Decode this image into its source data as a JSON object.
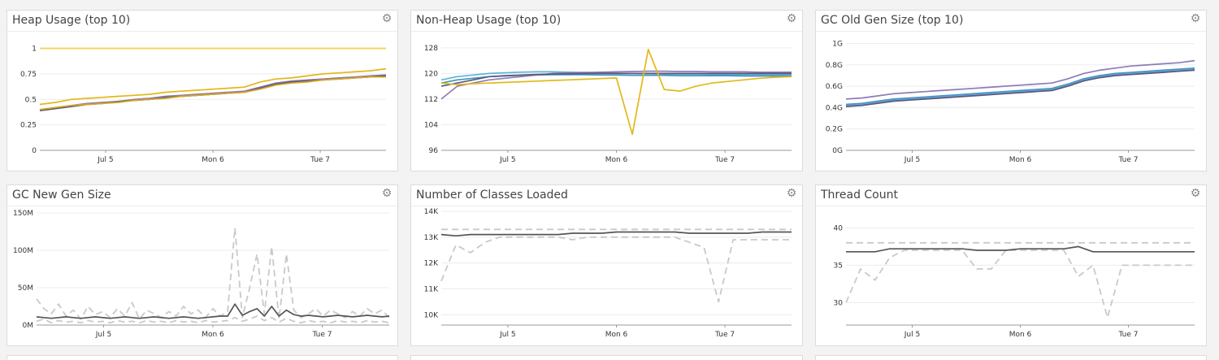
{
  "panels": [
    {
      "title": "Heap Usage (top 10)",
      "chart_data": {
        "type": "line",
        "x_ticks": [
          "Jul 5",
          "Mon 6",
          "Tue 7"
        ],
        "y_ticks": [
          "0",
          "0.25",
          "0.5",
          "0.75",
          "1"
        ],
        "ylim": [
          0,
          1.1
        ],
        "series": [
          {
            "color": "#f2d24b",
            "values": [
              1,
              1,
              1,
              1,
              1,
              1,
              1,
              1,
              1,
              1,
              1,
              1,
              1,
              1,
              1,
              1,
              1,
              1,
              1,
              1,
              1,
              1,
              1
            ]
          },
          {
            "color": "#e3b818",
            "values": [
              0.45,
              0.47,
              0.5,
              0.51,
              0.52,
              0.53,
              0.54,
              0.55,
              0.57,
              0.58,
              0.59,
              0.6,
              0.61,
              0.62,
              0.67,
              0.7,
              0.71,
              0.73,
              0.75,
              0.76,
              0.77,
              0.78,
              0.8
            ]
          },
          {
            "color": "#8f7bb5",
            "values": [
              0.4,
              0.42,
              0.44,
              0.46,
              0.47,
              0.48,
              0.5,
              0.51,
              0.53,
              0.54,
              0.55,
              0.56,
              0.57,
              0.58,
              0.62,
              0.66,
              0.68,
              0.69,
              0.7,
              0.71,
              0.72,
              0.73,
              0.74
            ]
          },
          {
            "color": "#5a5a78",
            "values": [
              0.39,
              0.41,
              0.43,
              0.45,
              0.46,
              0.48,
              0.49,
              0.5,
              0.52,
              0.53,
              0.54,
              0.55,
              0.56,
              0.57,
              0.61,
              0.65,
              0.67,
              0.68,
              0.69,
              0.7,
              0.71,
              0.72,
              0.73
            ]
          },
          {
            "color": "#d9a81a",
            "values": [
              0.4,
              0.42,
              0.44,
              0.45,
              0.46,
              0.47,
              0.49,
              0.5,
              0.51,
              0.53,
              0.54,
              0.55,
              0.56,
              0.57,
              0.6,
              0.64,
              0.66,
              0.67,
              0.69,
              0.7,
              0.71,
              0.72,
              0.72
            ]
          }
        ]
      }
    },
    {
      "title": "Non-Heap Usage (top 10)",
      "chart_data": {
        "type": "line",
        "x_ticks": [
          "Jul 5",
          "Mon 6",
          "Tue 7"
        ],
        "y_ticks": [
          "96",
          "104",
          "112",
          "120",
          "128"
        ],
        "ylim": [
          96,
          131
        ],
        "series": [
          {
            "color": "#5fb3d9",
            "values": [
              118,
              119,
              119.5,
              120,
              120.2,
              120.4,
              120.5,
              120.5,
              120.4,
              120.3,
              120.2,
              120.1,
              120,
              119.9,
              119.8,
              119.8,
              119.8,
              119.7,
              119.7,
              119.6,
              119.6,
              119.6,
              119.6
            ]
          },
          {
            "color": "#3f93c4",
            "values": [
              117,
              118,
              118.5,
              119,
              119.2,
              119.4,
              119.5,
              119.6,
              119.6,
              119.6,
              119.5,
              119.5,
              119.4,
              119.4,
              119.4,
              119.3,
              119.3,
              119.3,
              119.3,
              119.2,
              119.2,
              119.2,
              119.2
            ]
          },
          {
            "color": "#8f7bb5",
            "values": [
              112,
              116,
              117,
              118,
              118.5,
              119,
              119.5,
              120,
              120.2,
              120.3,
              120.4,
              120.5,
              120.6,
              120.7,
              120.7,
              120.6,
              120.6,
              120.5,
              120.5,
              120.5,
              120.4,
              120.4,
              120.4
            ]
          },
          {
            "color": "#5a5a78",
            "values": [
              116,
              117,
              118,
              119,
              119.3,
              119.5,
              119.7,
              119.8,
              119.9,
              120,
              120,
              120,
              120,
              120,
              120,
              120,
              120,
              120,
              120,
              120,
              120,
              120,
              120
            ]
          },
          {
            "color": "#e3b818",
            "values": [
              117,
              116.5,
              116.8,
              117,
              117.2,
              117.4,
              117.6,
              117.8,
              118,
              118.2,
              118.4,
              118.6,
              101,
              127.5,
              115,
              114.5,
              116,
              117,
              117.5,
              118,
              118.5,
              118.8,
              119
            ]
          }
        ]
      }
    },
    {
      "title": "GC Old Gen Size (top 10)",
      "chart_data": {
        "type": "line",
        "x_ticks": [
          "Jul 5",
          "Mon 6",
          "Tue 7"
        ],
        "y_ticks": [
          "0G",
          "0.2G",
          "0.4G",
          "0.6G",
          "0.8G",
          "1G"
        ],
        "ylim": [
          0,
          1.05
        ],
        "series": [
          {
            "color": "#8f7bb5",
            "values": [
              0.48,
              0.49,
              0.51,
              0.53,
              0.54,
              0.55,
              0.56,
              0.57,
              0.58,
              0.59,
              0.6,
              0.61,
              0.62,
              0.63,
              0.67,
              0.72,
              0.75,
              0.77,
              0.79,
              0.8,
              0.81,
              0.82,
              0.84
            ]
          },
          {
            "color": "#3f93c4",
            "values": [
              0.43,
              0.44,
              0.46,
              0.48,
              0.49,
              0.5,
              0.51,
              0.52,
              0.53,
              0.54,
              0.55,
              0.56,
              0.57,
              0.58,
              0.62,
              0.67,
              0.7,
              0.72,
              0.73,
              0.74,
              0.75,
              0.76,
              0.77
            ]
          },
          {
            "color": "#6a9fd4",
            "values": [
              0.42,
              0.43,
              0.45,
              0.47,
              0.48,
              0.49,
              0.5,
              0.51,
              0.52,
              0.53,
              0.54,
              0.55,
              0.56,
              0.57,
              0.61,
              0.66,
              0.69,
              0.71,
              0.72,
              0.73,
              0.74,
              0.75,
              0.76
            ]
          },
          {
            "color": "#5a5a78",
            "values": [
              0.41,
              0.42,
              0.44,
              0.46,
              0.47,
              0.48,
              0.49,
              0.5,
              0.51,
              0.52,
              0.53,
              0.54,
              0.55,
              0.56,
              0.6,
              0.65,
              0.68,
              0.7,
              0.71,
              0.72,
              0.73,
              0.74,
              0.75
            ]
          }
        ]
      }
    },
    {
      "title": "GC New Gen Size",
      "chart_data": {
        "type": "line",
        "x_ticks": [
          "Jul 5",
          "Mon 6",
          "Tue 7"
        ],
        "y_ticks": [
          "0M",
          "50M",
          "100M",
          "150M"
        ],
        "ylim": [
          0,
          150
        ],
        "series": [
          {
            "color": "#c9c9c9",
            "dashed": true,
            "values": [
              35,
              22,
              15,
              28,
              12,
              20,
              8,
              25,
              14,
              18,
              10,
              22,
              12,
              30,
              8,
              20,
              15,
              10,
              18,
              12,
              25,
              15,
              20,
              10,
              22,
              12,
              18,
              130,
              10,
              50,
              95,
              15,
              105,
              8,
              95,
              20,
              10,
              15,
              22,
              12,
              20,
              15,
              10,
              18,
              12,
              22,
              15,
              20,
              10
            ]
          },
          {
            "color": "#c9c9c9",
            "dashed": true,
            "values": [
              5,
              8,
              3,
              6,
              4,
              5,
              3,
              6,
              4,
              5,
              3,
              6,
              4,
              5,
              3,
              6,
              4,
              5,
              3,
              6,
              4,
              5,
              3,
              6,
              4,
              5,
              6,
              10,
              5,
              8,
              12,
              6,
              10,
              4,
              9,
              5,
              3,
              6,
              4,
              5,
              3,
              6,
              4,
              5,
              3,
              6,
              4,
              5,
              3
            ]
          },
          {
            "color": "#555555",
            "values": [
              11,
              10,
              9,
              10,
              11,
              10,
              9,
              10,
              11,
              10,
              9,
              10,
              11,
              10,
              9,
              10,
              11,
              10,
              9,
              10,
              11,
              10,
              9,
              10,
              11,
              12,
              12,
              28,
              13,
              18,
              22,
              12,
              25,
              12,
              20,
              14,
              12,
              13,
              12,
              11,
              12,
              13,
              12,
              11,
              12,
              13,
              12,
              11,
              12
            ]
          }
        ]
      }
    },
    {
      "title": "Number of Classes Loaded",
      "chart_data": {
        "type": "line",
        "x_ticks": [
          "Jul 5",
          "Mon 6",
          "Tue 7"
        ],
        "y_ticks": [
          "10K",
          "11K",
          "12K",
          "13K",
          "14K"
        ],
        "ylim": [
          9600,
          14000
        ],
        "series": [
          {
            "color": "#c9c9c9",
            "dashed": true,
            "values": [
              13300,
              13300,
              13300,
              13300,
              13300,
              13300,
              13300,
              13300,
              13300,
              13300,
              13300,
              13300,
              13300,
              13300,
              13300,
              13300,
              13300,
              13300,
              13300,
              13300,
              13300,
              13300,
              13300,
              13300,
              13300
            ]
          },
          {
            "color": "#c9c9c9",
            "dashed": true,
            "values": [
              11300,
              12700,
              12400,
              12800,
              13000,
              13000,
              13000,
              13000,
              13000,
              12900,
              13000,
              13000,
              13000,
              13000,
              13000,
              13000,
              13000,
              12800,
              12600,
              10500,
              12900,
              12900,
              12900,
              12900,
              12900
            ]
          },
          {
            "color": "#555555",
            "values": [
              13100,
              13050,
              13100,
              13100,
              13100,
              13100,
              13100,
              13100,
              13100,
              13150,
              13150,
              13150,
              13200,
              13200,
              13200,
              13200,
              13200,
              13150,
              13150,
              13150,
              13150,
              13150,
              13200,
              13200,
              13200
            ]
          }
        ]
      }
    },
    {
      "title": "Thread Count",
      "chart_data": {
        "type": "line",
        "x_ticks": [
          "Jul 5",
          "Mon 6",
          "Tue 7"
        ],
        "y_ticks": [
          "30",
          "35",
          "40"
        ],
        "ylim": [
          27,
          42
        ],
        "series": [
          {
            "color": "#c9c9c9",
            "dashed": true,
            "values": [
              38,
              38,
              38,
              38,
              38,
              38,
              38,
              38,
              38,
              38,
              38,
              38,
              38,
              38,
              38,
              38,
              38,
              38,
              38,
              38,
              38,
              38,
              38,
              38,
              38
            ]
          },
          {
            "color": "#c9c9c9",
            "dashed": true,
            "values": [
              30,
              34.5,
              33,
              36,
              37,
              37,
              37,
              37,
              37,
              34.5,
              34.5,
              37,
              37,
              37,
              37,
              37,
              33.5,
              35,
              28,
              35,
              35,
              35,
              35,
              35,
              35
            ]
          },
          {
            "color": "#555555",
            "values": [
              36.8,
              36.8,
              36.8,
              37.2,
              37.2,
              37.2,
              37.2,
              37.2,
              37.2,
              37,
              37,
              37,
              37.2,
              37.2,
              37.2,
              37.2,
              37.5,
              36.8,
              36.8,
              36.8,
              36.8,
              36.8,
              36.8,
              36.8,
              36.8
            ]
          }
        ]
      }
    }
  ]
}
